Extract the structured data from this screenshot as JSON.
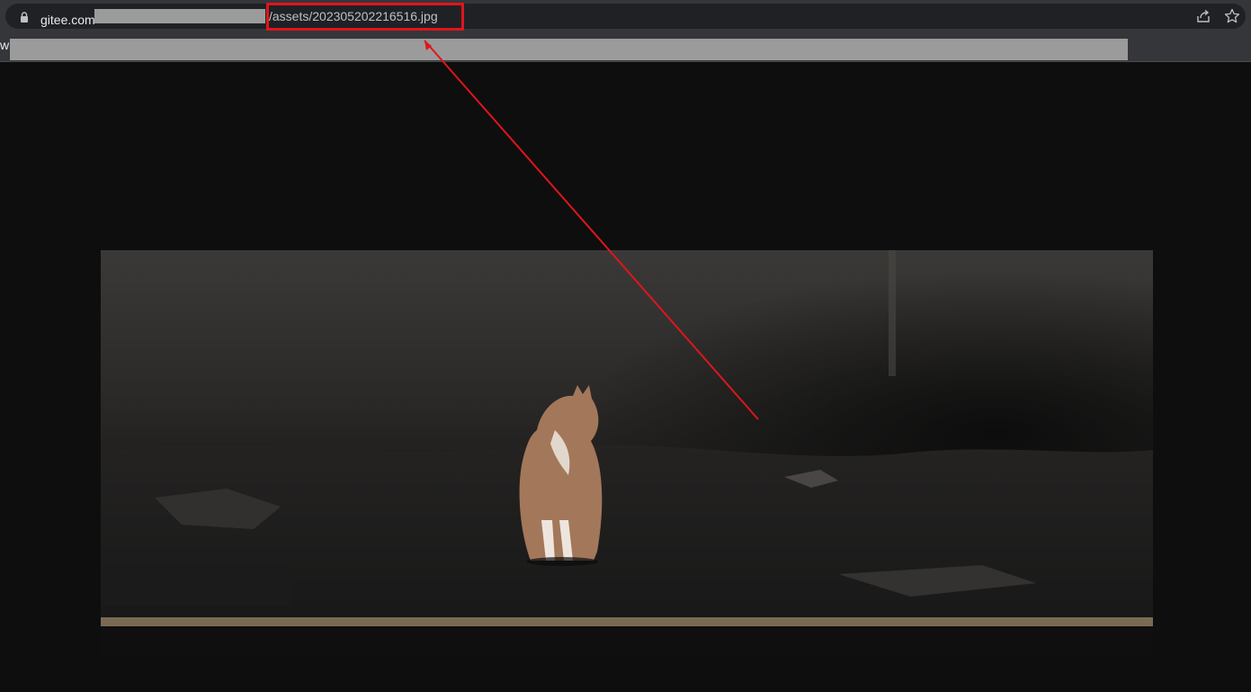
{
  "address_bar": {
    "domain": "gitee.com",
    "path": "/assets/202305202216516.jpg"
  },
  "bookmarks_bar": {
    "first_letter": "w"
  },
  "icons": {
    "lock": "lock-icon",
    "share": "share-icon",
    "bookmark": "star-icon"
  },
  "colors": {
    "highlight": "#e0151c",
    "viewer_background": "#0e0e0e"
  }
}
